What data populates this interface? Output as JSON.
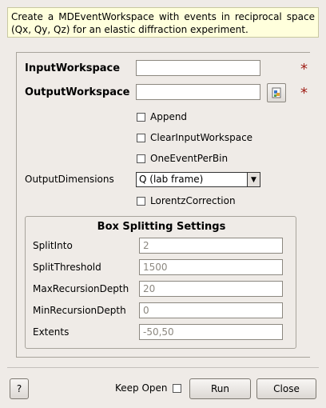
{
  "description": "Create a MDEventWorkspace with events in reciprocal space (Qx, Qy, Qz) for an elastic diffraction experiment.",
  "fields": {
    "input_workspace": {
      "label": "InputWorkspace",
      "value": ""
    },
    "output_workspace": {
      "label": "OutputWorkspace",
      "value": ""
    },
    "required_marker": "*"
  },
  "checkboxes": {
    "append": "Append",
    "clear_input": "ClearInputWorkspace",
    "one_event_per_bin": "OneEventPerBin",
    "lorentz_correction": "LorentzCorrection"
  },
  "output_dimensions": {
    "label": "OutputDimensions",
    "value": "Q (lab frame)"
  },
  "box_splitting": {
    "title": "Box Splitting Settings",
    "rows": [
      {
        "label": "SplitInto",
        "value": "2"
      },
      {
        "label": "SplitThreshold",
        "value": "1500"
      },
      {
        "label": "MaxRecursionDepth",
        "value": "20"
      },
      {
        "label": "MinRecursionDepth",
        "value": "0"
      },
      {
        "label": "Extents",
        "value": "-50,50"
      }
    ]
  },
  "footer": {
    "help": "?",
    "keep_open": "Keep Open",
    "run": "Run",
    "close": "Close"
  }
}
